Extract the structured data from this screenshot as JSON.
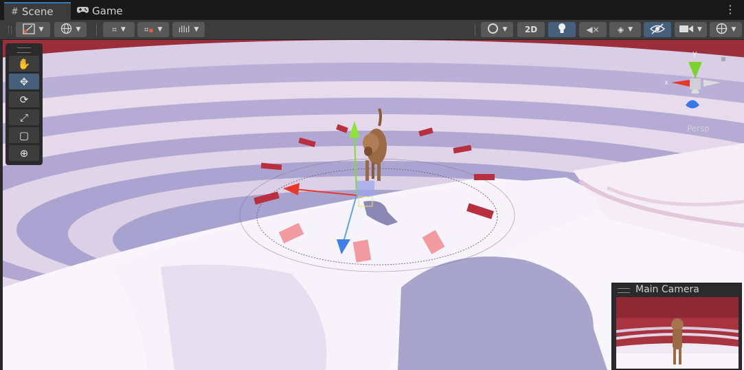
{
  "tabs": [
    {
      "label": "Scene",
      "icon": "hash-icon",
      "active": true
    },
    {
      "label": "Game",
      "icon": "gamepad-icon",
      "active": false
    }
  ],
  "toolbar": {
    "mode_2d_label": "2D"
  },
  "tools": [
    {
      "name": "hand-tool",
      "icon": "✋",
      "active": false
    },
    {
      "name": "move-tool",
      "icon": "✥",
      "active": true
    },
    {
      "name": "rotate-tool",
      "icon": "⟳",
      "active": false
    },
    {
      "name": "scale-tool",
      "icon": "⤢",
      "active": false
    },
    {
      "name": "rect-tool",
      "icon": "▢",
      "active": false
    },
    {
      "name": "transform-tool",
      "icon": "⊕",
      "active": false
    }
  ],
  "gizmo": {
    "y_label": "y",
    "x_label": "x",
    "projection_label": "Persp"
  },
  "camera_preview": {
    "title": "Main Camera"
  },
  "colors": {
    "accent": "#46607c",
    "floor_marker": "#b8303f",
    "scene_wall": "#a83a44",
    "floor": "#a8a4cc"
  }
}
